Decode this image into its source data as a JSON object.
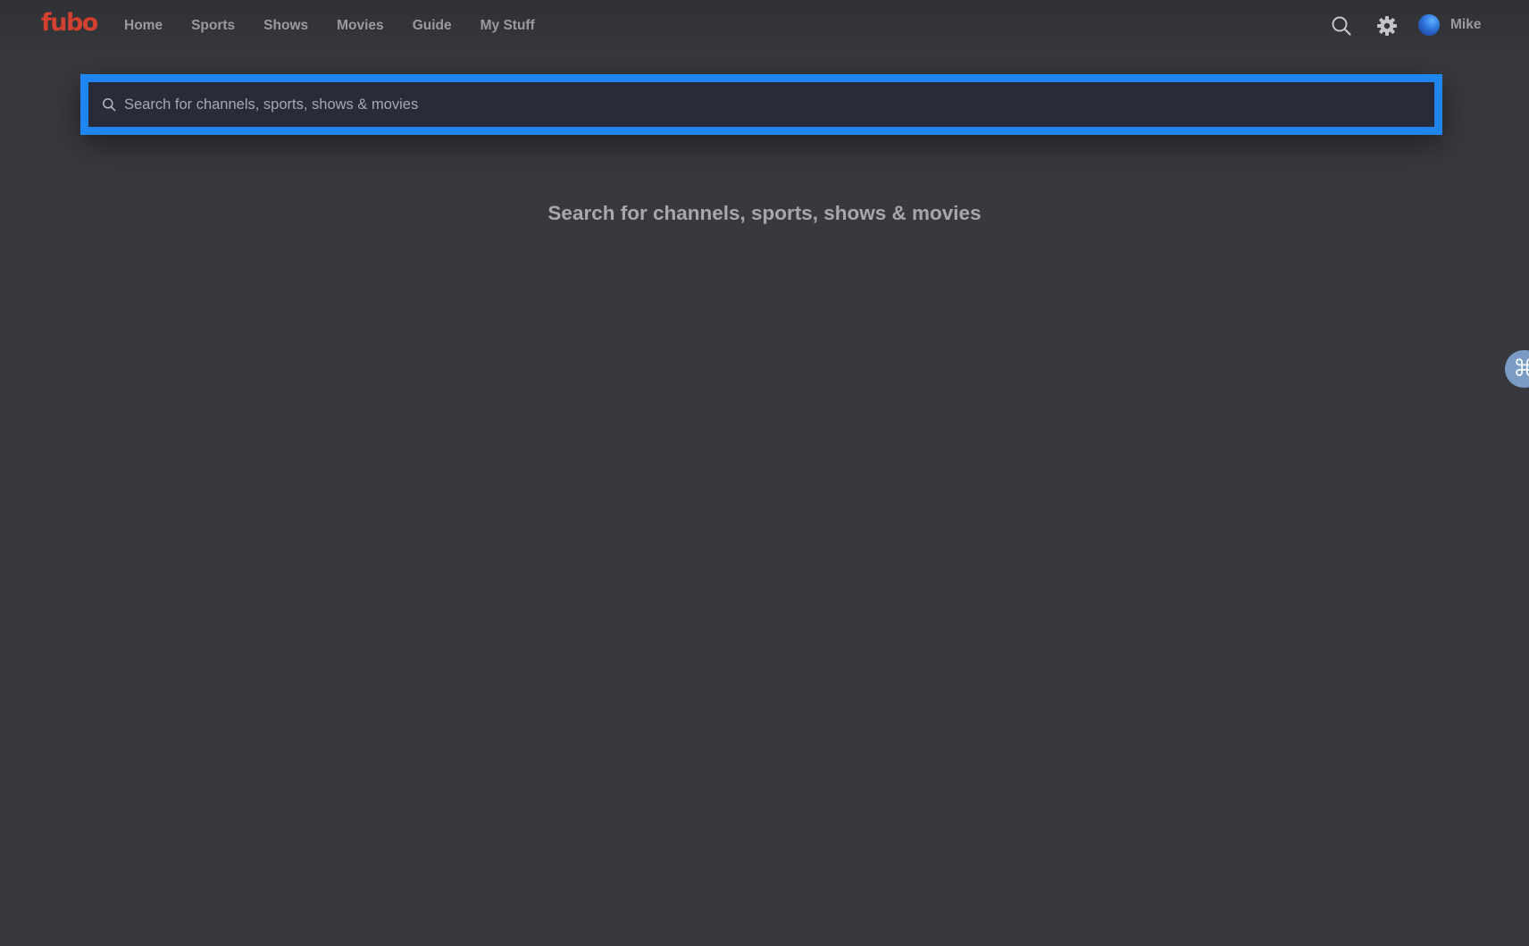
{
  "app": {
    "logo_text": "fubo",
    "brand_color": "#d2402f",
    "accent_color": "#1f85f0"
  },
  "nav": {
    "items": [
      {
        "label": "Home"
      },
      {
        "label": "Sports"
      },
      {
        "label": "Shows"
      },
      {
        "label": "Movies"
      },
      {
        "label": "Guide"
      },
      {
        "label": "My Stuff"
      }
    ]
  },
  "header": {
    "search_icon": "search-icon",
    "settings_icon": "gear-icon",
    "user_name": "Mike"
  },
  "search": {
    "value": "",
    "placeholder": "Search for channels, sports, shows & movies",
    "icon": "search-icon"
  },
  "main": {
    "empty_state_title": "Search for channels, sports, shows & movies"
  },
  "side_widget": {
    "glyph": "⌘",
    "icon": "command-icon"
  }
}
